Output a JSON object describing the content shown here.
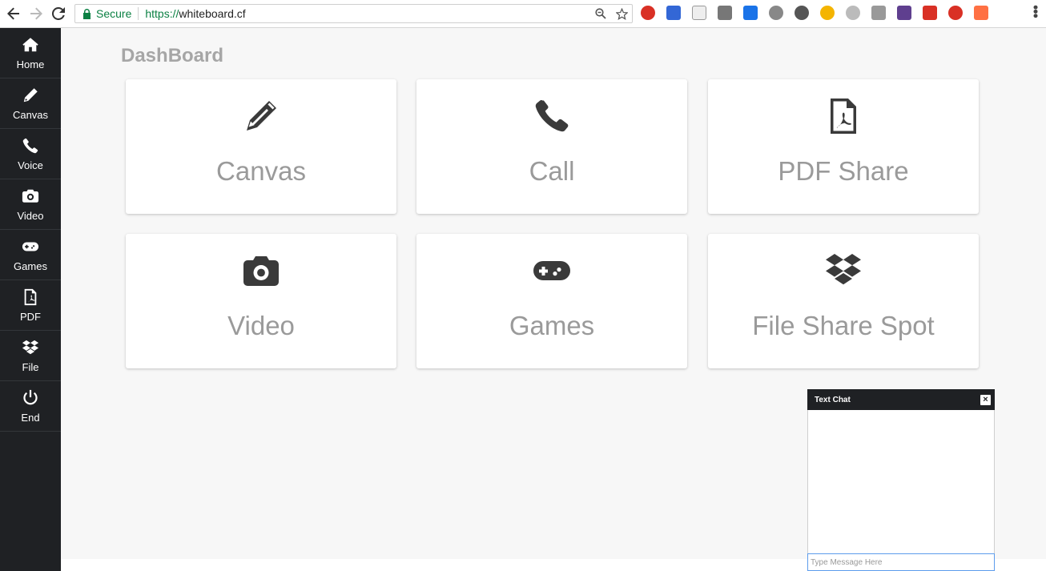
{
  "browser": {
    "secure_label": "Secure",
    "url_scheme": "https://",
    "url_host": "whiteboard.cf",
    "extension_colors": [
      "#d93025",
      "#3367d6",
      "#888888",
      "#777777",
      "#1a73e8",
      "#888888",
      "#555555",
      "#f4b400",
      "#bbbbbb",
      "#999999",
      "#5f6368",
      "#d93025",
      "#d93025",
      "#ff7043"
    ]
  },
  "sidebar": {
    "items": [
      {
        "label": "Home",
        "icon": "home-icon"
      },
      {
        "label": "Canvas",
        "icon": "pencil-icon"
      },
      {
        "label": "Voice",
        "icon": "phone-icon"
      },
      {
        "label": "Video",
        "icon": "camera-icon"
      },
      {
        "label": "Games",
        "icon": "gamepad-icon"
      },
      {
        "label": "PDF",
        "icon": "pdf-icon"
      },
      {
        "label": "File",
        "icon": "dropbox-icon"
      },
      {
        "label": "End",
        "icon": "power-icon"
      }
    ]
  },
  "dashboard": {
    "title": "DashBoard",
    "cards": [
      {
        "label": "Canvas",
        "icon": "pencil-icon"
      },
      {
        "label": "Call",
        "icon": "phone-icon"
      },
      {
        "label": "PDF Share",
        "icon": "pdf-icon"
      },
      {
        "label": "Video",
        "icon": "camera-icon"
      },
      {
        "label": "Games",
        "icon": "gamepad-icon"
      },
      {
        "label": "File Share Spot",
        "icon": "dropbox-icon"
      }
    ]
  },
  "chat": {
    "title": "Text Chat",
    "close_label": "×",
    "input_placeholder": "Type Message Here"
  }
}
